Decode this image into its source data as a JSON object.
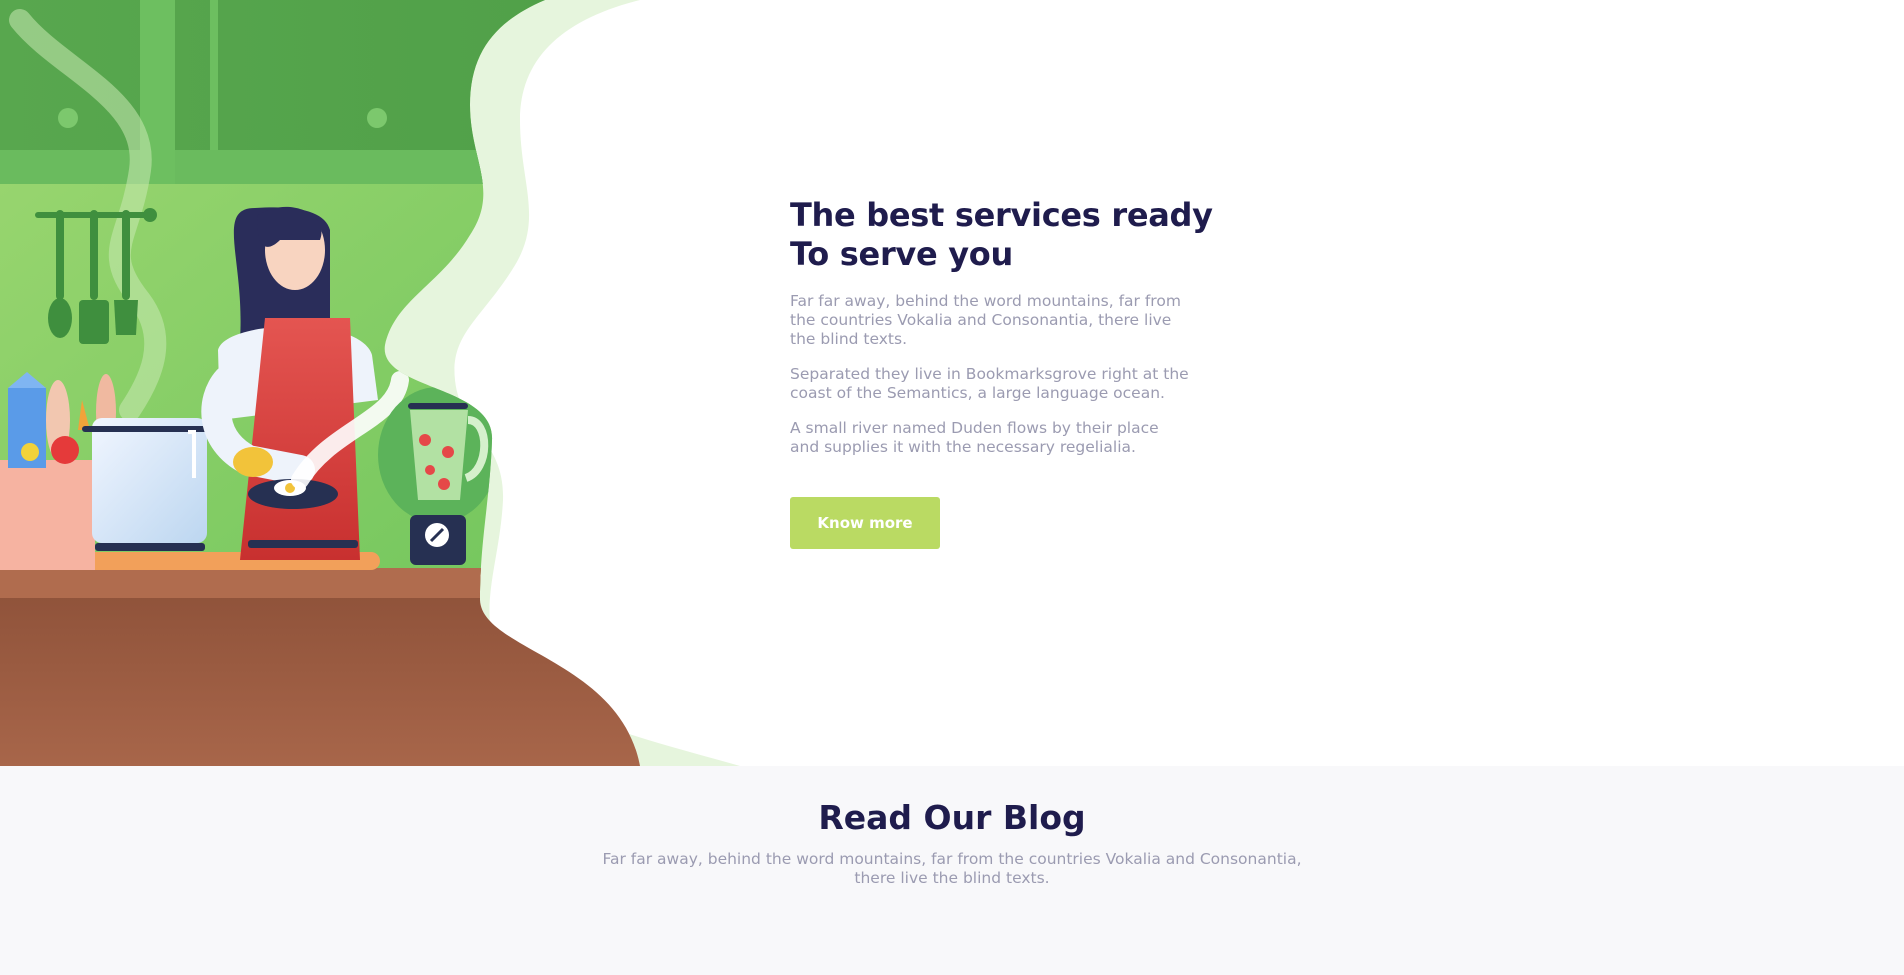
{
  "hero": {
    "title": "The best services ready To serve you",
    "paragraphs": [
      "Far far away, behind the word mountains, far from the countries Vokalia and Consonantia, there live the blind texts.",
      "Separated they live in Bookmarksgrove right at the coast of the Semantics, a large language ocean.",
      "A small river named Duden flows by their place and supplies it with the necessary regelialia."
    ],
    "cta_label": "Know more"
  },
  "illustration": {
    "subject": "cooking-woman-kitchen-illustration",
    "icons": [
      "cooking-woman",
      "frying-pan",
      "blender",
      "pot",
      "hanging-utensils",
      "grocery-bag",
      "steam"
    ]
  },
  "blog": {
    "title": "Read Our Blog",
    "subtitle": "Far far away, behind the word mountains, far from the countries Vokalia and Consonantia, there live the blind texts."
  },
  "colors": {
    "heading": "#1f1c4d",
    "body_text": "#9b9bb1",
    "accent": "#bada63",
    "green_dark": "#56a64d",
    "green_light": "#8fd16a",
    "counter_brown": "#9a5a3e",
    "blog_bg": "#f8f8fa"
  }
}
